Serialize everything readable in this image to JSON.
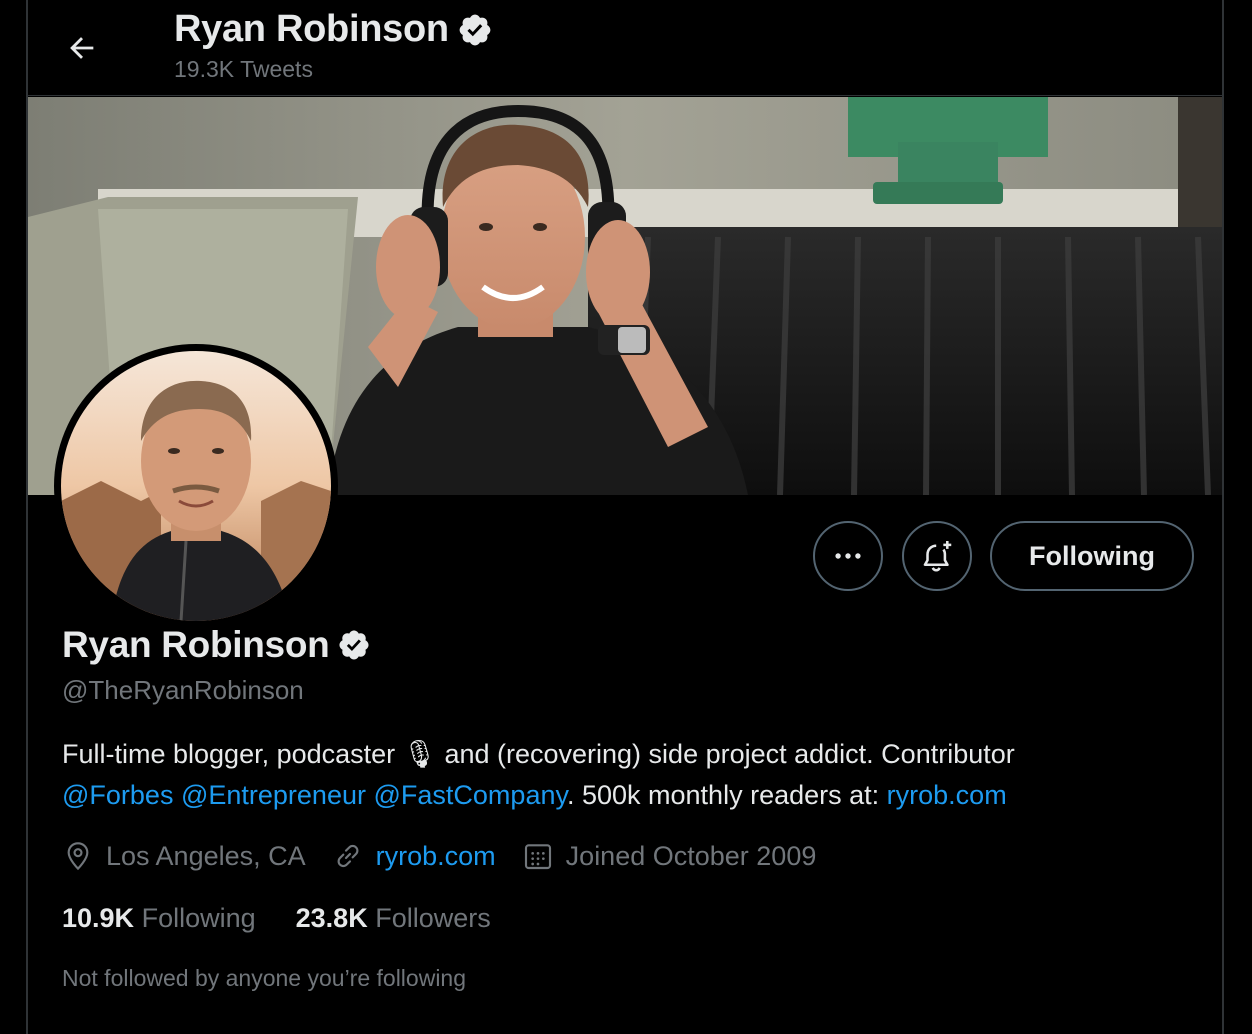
{
  "header": {
    "title": "Ryan Robinson",
    "tweet_count": "19.3K Tweets",
    "back_icon": "arrow-left-icon"
  },
  "profile": {
    "name": "Ryan Robinson",
    "handle": "@TheRyanRobinson",
    "verified_icon": "verified-badge-icon",
    "bio": {
      "part1": "Full-time blogger, podcaster ",
      "emoji": "🎙",
      "part2": " and (recovering) side project addict. Contributor",
      "mention1": "@Forbes",
      "mention2": "@Entrepreneur",
      "mention3": "@FastCompany",
      "part3": ". 500k monthly readers at: ",
      "link": "ryrob.com"
    },
    "location": "Los Angeles, CA",
    "website": "ryrob.com",
    "joined": "Joined October 2009",
    "following_count": "10.9K",
    "following_label": "Following",
    "followers_count": "23.8K",
    "followers_label": "Followers",
    "not_followed_text": "Not followed by anyone you’re following"
  },
  "actions": {
    "more_icon": "more-dots-icon",
    "notify_icon": "bell-plus-icon",
    "following_button": "Following"
  },
  "colors": {
    "background": "#000000",
    "link": "#1d9bf0",
    "secondary_text": "#71767b",
    "border": "#2f3336"
  }
}
